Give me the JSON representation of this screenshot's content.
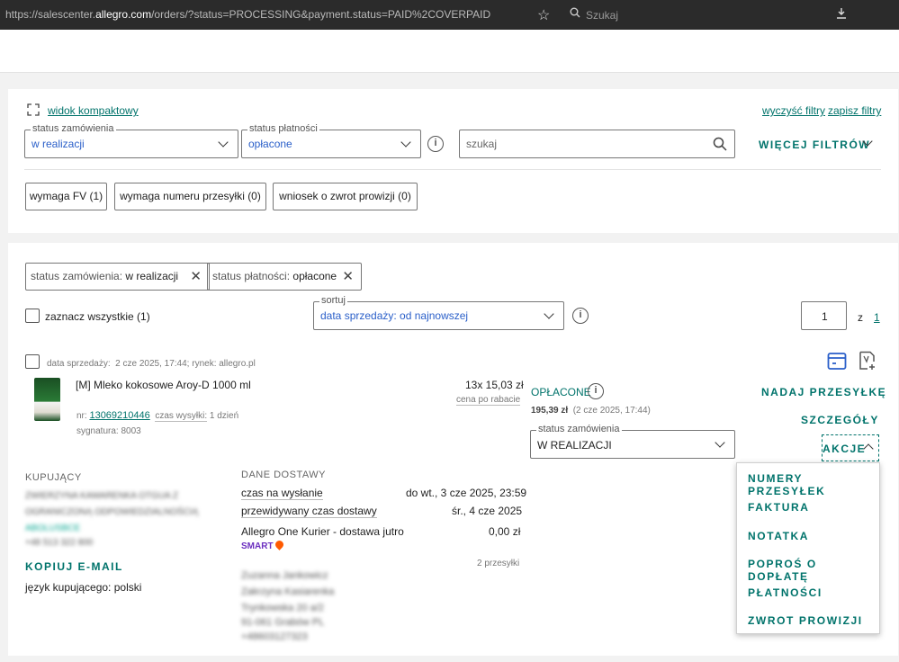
{
  "browser": {
    "url_prefix": "https://salescenter.",
    "url_domain": "allegro.com",
    "url_rest": "/orders/?status=PROCESSING&payment.status=PAID%2COVERPAID",
    "search_placeholder": "Szukaj"
  },
  "filters": {
    "compact_view": "widok kompaktowy",
    "clear_filters": "wyczyść filtry",
    "save_filters": "zapisz filtry",
    "order_status_legend": "status zamówienia",
    "order_status_value": "w realizacji",
    "payment_status_legend": "status płatności",
    "payment_status_value": "opłacone",
    "search_placeholder": "szukaj",
    "more_filters": "WIĘCEJ FILTRÓW",
    "quick": [
      "wymaga FV (1)",
      "wymaga numeru przesyłki (0)",
      "wniosek o zwrot prowizji (0)"
    ]
  },
  "active_chips": [
    {
      "label": "status zamówienia:",
      "value": "w realizacji"
    },
    {
      "label": "status płatności:",
      "value": "opłacone"
    }
  ],
  "list": {
    "select_all": "zaznacz wszystkie (1)",
    "sort_legend": "sortuj",
    "sort_value": "data sprzedaży: od najnowszej",
    "page": "1",
    "of": "z",
    "pages": "1"
  },
  "order": {
    "sale_label": "data sprzedaży:",
    "sale_value": "2 cze 2025, 17:44; rynek: allegro.pl",
    "product_name": "[M] Mleko kokosowe Aroy-D 1000 ml",
    "qty_price": "13x 15,03 zł",
    "price_note": "cena po rabacie",
    "nr_label": "nr:",
    "nr_value": "13069210446",
    "ship_time_label": "czas wysyłki:",
    "ship_time_value": "1 dzień",
    "signature": "sygnatura: 8003",
    "payment_status": "OPŁACONE",
    "paid_amount": "195,39 zł",
    "paid_date": "(2 cze 2025, 17:44)",
    "status_legend": "status zamówienia",
    "status_value": "W REALIZACJI",
    "send_parcel": "NADAJ PRZESYŁKĘ",
    "details": "SZCZEGÓŁY",
    "actions": "AKCJE",
    "buyer_heading": "KUPUJĄCY",
    "buyer_lines": [
      "ZWIERZYNA KAMARENKA OTGUA Z",
      "OGRANICZONĄ ODPOWIEDZIALNOŚCIĄ",
      "ABOLUSBCE",
      "+48 513 322 800"
    ],
    "copy_email": "KOPIUJ E-MAIL",
    "buyer_language": "język kupującego: polski",
    "delivery_heading": "DANE DOSTAWY",
    "time_to_send_label": "czas na wysłanie",
    "time_to_send_value": "do wt., 3 cze 2025, 23:59",
    "est_delivery_label": "przewidywany czas dostawy",
    "est_delivery_value": "śr., 4 cze 2025",
    "carrier": "Allegro One Kurier - dostawa jutro",
    "carrier_price": "0,00 zł",
    "smart": "SMART",
    "parcels": "2 przesyłki",
    "address_lines": [
      "Zuzanna Jankowicz",
      "Zakrzyna Kasiarenka",
      "Trynkowska 20 a/2",
      "91-061 Grabów PL",
      "+48603127323"
    ]
  },
  "actions_menu": [
    "NUMERY PRZESYŁEK",
    "FAKTURA",
    "NOTATKA",
    "POPROŚ O DOPŁATĘ",
    "PŁATNOŚCI",
    "ZWROT PROWIZJI"
  ],
  "colors": {
    "accent": "#00736b",
    "link_blue": "#2a5fc9",
    "smart_orange": "#ff5a00"
  }
}
